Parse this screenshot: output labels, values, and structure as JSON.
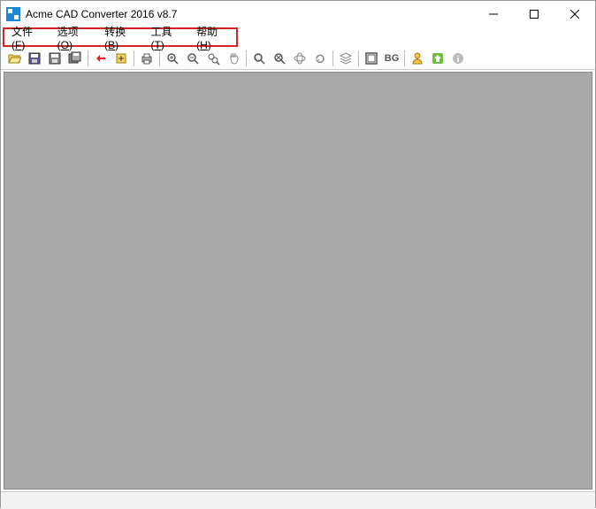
{
  "window": {
    "title": "Acme CAD Converter 2016 v8.7"
  },
  "menu": {
    "file": {
      "label": "文件",
      "hotkey": "F"
    },
    "options": {
      "label": "选项",
      "hotkey": "O"
    },
    "convert": {
      "label": "转换",
      "hotkey": "B"
    },
    "tools": {
      "label": "工具",
      "hotkey": "T"
    },
    "help": {
      "label": "帮助",
      "hotkey": "H"
    }
  },
  "toolbar": {
    "bg_label": "BG"
  }
}
